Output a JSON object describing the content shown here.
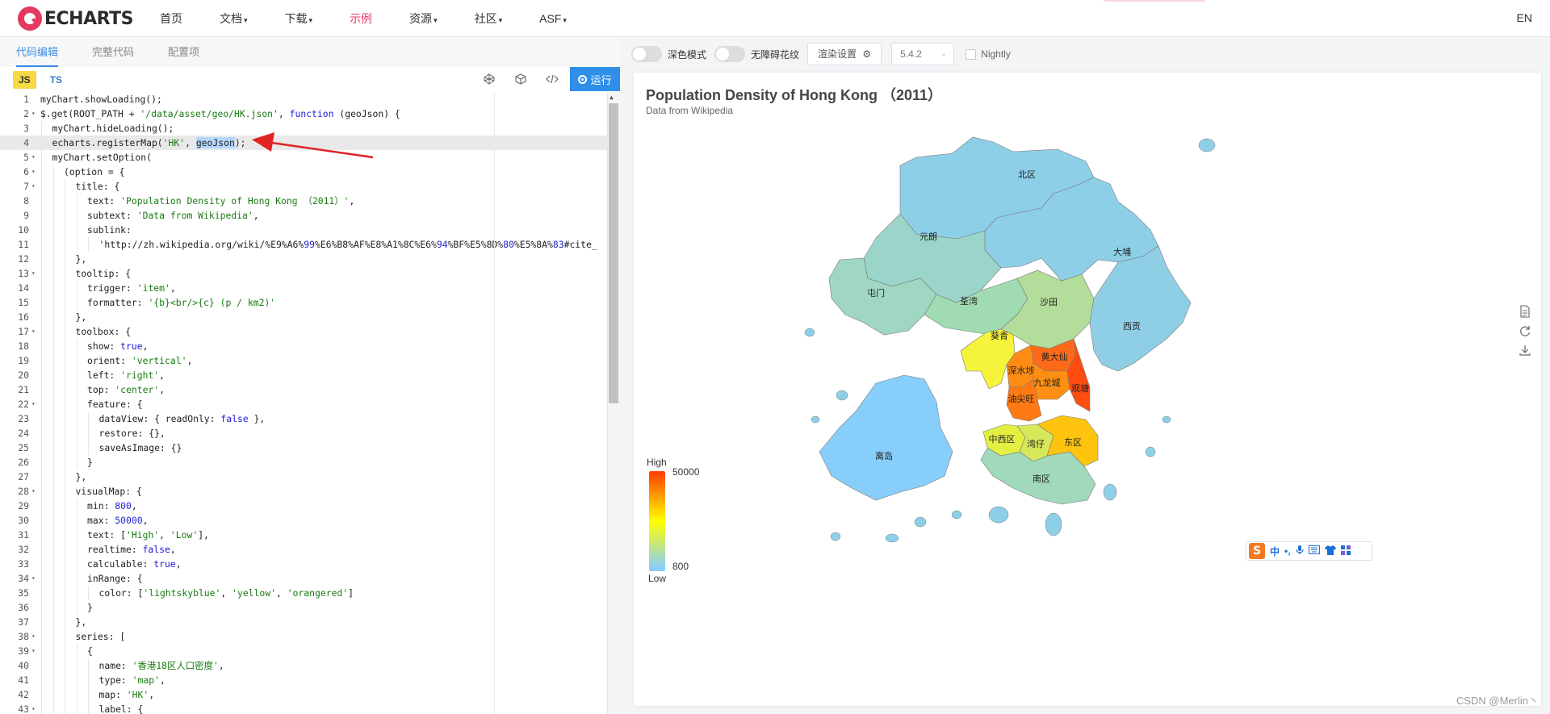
{
  "navbar": {
    "logo_text": "ECHARTS",
    "items": [
      {
        "label": "首页",
        "dropdown": false,
        "active": false
      },
      {
        "label": "文档",
        "dropdown": true,
        "active": false
      },
      {
        "label": "下载",
        "dropdown": true,
        "active": false
      },
      {
        "label": "示例",
        "dropdown": false,
        "active": true
      },
      {
        "label": "资源",
        "dropdown": true,
        "active": false
      },
      {
        "label": "社区",
        "dropdown": true,
        "active": false
      },
      {
        "label": "ASF",
        "dropdown": true,
        "active": false
      }
    ],
    "lang": "EN",
    "active_color": "#e43961"
  },
  "editor": {
    "tabs": [
      "代码编辑",
      "完整代码",
      "配置项"
    ],
    "active_tab": "代码编辑",
    "languages": [
      "JS",
      "TS"
    ],
    "run_label": "运行",
    "lines": [
      {
        "n": "1",
        "fold": false,
        "indent": 0,
        "text": "myChart.showLoading();"
      },
      {
        "n": "2",
        "fold": true,
        "indent": 0,
        "text": "$.get(ROOT_PATH + '/data/asset/geo/HK.json', function (geoJson) {"
      },
      {
        "n": "3",
        "fold": false,
        "indent": 1,
        "text": "myChart.hideLoading();"
      },
      {
        "n": "4",
        "fold": false,
        "indent": 1,
        "text": "echarts.registerMap('HK', geoJson);",
        "highlight": true
      },
      {
        "n": "5",
        "fold": true,
        "indent": 1,
        "text": "myChart.setOption("
      },
      {
        "n": "6",
        "fold": true,
        "indent": 2,
        "text": "(option = {"
      },
      {
        "n": "7",
        "fold": true,
        "indent": 3,
        "text": "title: {"
      },
      {
        "n": "8",
        "fold": false,
        "indent": 4,
        "text": "text: 'Population Density of Hong Kong （2011）',"
      },
      {
        "n": "9",
        "fold": false,
        "indent": 4,
        "text": "subtext: 'Data from Wikipedia',"
      },
      {
        "n": "10",
        "fold": false,
        "indent": 4,
        "text": "sublink:"
      },
      {
        "n": "11",
        "fold": false,
        "indent": 5,
        "text": "'http://zh.wikipedia.org/wiki/%E9%A6%99%E6%B8%AF%E8%A1%8C%E6%94%BF%E5%8D%80%E5%8A%83#cite_"
      },
      {
        "n": "12",
        "fold": false,
        "indent": 3,
        "text": "},"
      },
      {
        "n": "13",
        "fold": true,
        "indent": 3,
        "text": "tooltip: {"
      },
      {
        "n": "14",
        "fold": false,
        "indent": 4,
        "text": "trigger: 'item',"
      },
      {
        "n": "15",
        "fold": false,
        "indent": 4,
        "text": "formatter: '{b}<br/>{c} (p / km2)'"
      },
      {
        "n": "16",
        "fold": false,
        "indent": 3,
        "text": "},"
      },
      {
        "n": "17",
        "fold": true,
        "indent": 3,
        "text": "toolbox: {"
      },
      {
        "n": "18",
        "fold": false,
        "indent": 4,
        "text": "show: true,"
      },
      {
        "n": "19",
        "fold": false,
        "indent": 4,
        "text": "orient: 'vertical',"
      },
      {
        "n": "20",
        "fold": false,
        "indent": 4,
        "text": "left: 'right',"
      },
      {
        "n": "21",
        "fold": false,
        "indent": 4,
        "text": "top: 'center',"
      },
      {
        "n": "22",
        "fold": true,
        "indent": 4,
        "text": "feature: {"
      },
      {
        "n": "23",
        "fold": false,
        "indent": 5,
        "text": "dataView: { readOnly: false },"
      },
      {
        "n": "24",
        "fold": false,
        "indent": 5,
        "text": "restore: {},"
      },
      {
        "n": "25",
        "fold": false,
        "indent": 5,
        "text": "saveAsImage: {}"
      },
      {
        "n": "26",
        "fold": false,
        "indent": 4,
        "text": "}"
      },
      {
        "n": "27",
        "fold": false,
        "indent": 3,
        "text": "},"
      },
      {
        "n": "28",
        "fold": true,
        "indent": 3,
        "text": "visualMap: {"
      },
      {
        "n": "29",
        "fold": false,
        "indent": 4,
        "text": "min: 800,"
      },
      {
        "n": "30",
        "fold": false,
        "indent": 4,
        "text": "max: 50000,"
      },
      {
        "n": "31",
        "fold": false,
        "indent": 4,
        "text": "text: ['High', 'Low'],"
      },
      {
        "n": "32",
        "fold": false,
        "indent": 4,
        "text": "realtime: false,"
      },
      {
        "n": "33",
        "fold": false,
        "indent": 4,
        "text": "calculable: true,"
      },
      {
        "n": "34",
        "fold": true,
        "indent": 4,
        "text": "inRange: {"
      },
      {
        "n": "35",
        "fold": false,
        "indent": 5,
        "text": "color: ['lightskyblue', 'yellow', 'orangered']"
      },
      {
        "n": "36",
        "fold": false,
        "indent": 4,
        "text": "}"
      },
      {
        "n": "37",
        "fold": false,
        "indent": 3,
        "text": "},"
      },
      {
        "n": "38",
        "fold": true,
        "indent": 3,
        "text": "series: ["
      },
      {
        "n": "39",
        "fold": true,
        "indent": 4,
        "text": "{"
      },
      {
        "n": "40",
        "fold": false,
        "indent": 5,
        "text": "name: '香港18区人口密度',"
      },
      {
        "n": "41",
        "fold": false,
        "indent": 5,
        "text": "type: 'map',"
      },
      {
        "n": "42",
        "fold": false,
        "indent": 5,
        "text": "map: 'HK',"
      },
      {
        "n": "43",
        "fold": true,
        "indent": 5,
        "text": "label: {"
      }
    ]
  },
  "preview": {
    "dark_mode_label": "深色模式",
    "aria_label": "无障碍花纹",
    "render_settings_label": "渲染设置",
    "version": "5.4.2",
    "nightly_label": "Nightly"
  },
  "chart": {
    "title": "Population Density of Hong Kong （2011）",
    "subtitle": "Data from Wikipedia",
    "visual_map": {
      "high_text": "High",
      "low_text": "Low",
      "max_label": "50000",
      "min_label": "800",
      "colors": [
        "lightskyblue",
        "yellow",
        "orangered"
      ]
    },
    "regions": [
      {
        "name": "北区",
        "color": "#8ecfe8"
      },
      {
        "name": "大埔",
        "color": "#8ecfe8"
      },
      {
        "name": "元朗",
        "color": "#9bd5c9"
      },
      {
        "name": "屯门",
        "color": "#9fd7c2"
      },
      {
        "name": "荃湾",
        "color": "#a1dbb2"
      },
      {
        "name": "沙田",
        "color": "#b2dd9a"
      },
      {
        "name": "西贡",
        "color": "#8fcfe6"
      },
      {
        "name": "葵青",
        "color": "#f5f33a"
      },
      {
        "name": "黄大仙",
        "color": "#ff6a1a"
      },
      {
        "name": "深水埗",
        "color": "#ff8c15"
      },
      {
        "name": "九龙城",
        "color": "#ff8f12"
      },
      {
        "name": "观塘",
        "color": "#ff4c10"
      },
      {
        "name": "油尖旺",
        "color": "#ff7a14"
      },
      {
        "name": "离岛",
        "color": "#87cefa"
      },
      {
        "name": "中西区",
        "color": "#e4ef42"
      },
      {
        "name": "湾仔",
        "color": "#d7e85a"
      },
      {
        "name": "东区",
        "color": "#ffc40e"
      },
      {
        "name": "南区",
        "color": "#a0d9bc"
      }
    ]
  },
  "ime": {
    "logo": "S",
    "items": [
      "中",
      "•,",
      "🎤",
      "⌨",
      "👕",
      "▦"
    ]
  },
  "watermark": "CSDN @Merlin丶"
}
